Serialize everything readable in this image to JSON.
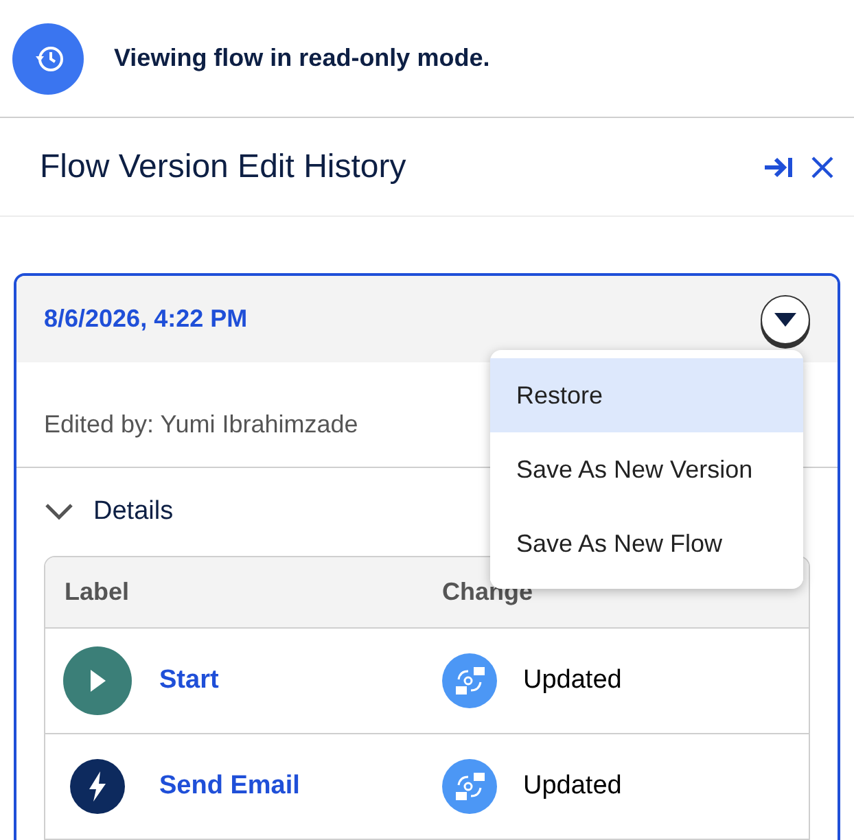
{
  "banner": {
    "text": "Viewing flow in read-only mode."
  },
  "panel": {
    "title": "Flow Version Edit History"
  },
  "version": {
    "timestamp": "8/6/2026, 4:22 PM",
    "edited_by": "Edited by: Yumi Ibrahimzade",
    "menu_open": true,
    "menu": [
      {
        "label": "Restore",
        "selected": true
      },
      {
        "label": "Save As New Version",
        "selected": false
      },
      {
        "label": "Save As New Flow",
        "selected": false
      }
    ],
    "details": {
      "label": "Details",
      "expanded": true,
      "columns": [
        "Label",
        "Change"
      ],
      "rows": [
        {
          "kind": "start",
          "label": "Start",
          "change": "Updated"
        },
        {
          "kind": "action",
          "label": "Send Email",
          "change": "Updated"
        }
      ]
    }
  }
}
